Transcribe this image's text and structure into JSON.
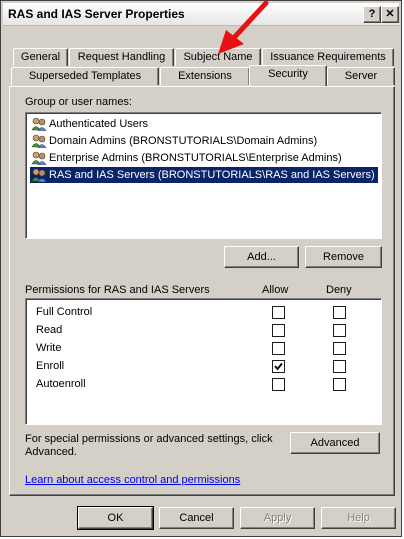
{
  "window": {
    "title": "RAS and IAS Server Properties",
    "help_glyph": "?",
    "close_glyph": "✕"
  },
  "tabs_row1": [
    "General",
    "Request Handling",
    "Subject Name",
    "Issuance Requirements"
  ],
  "tabs_row2": [
    "Superseded Templates",
    "Extensions",
    "Security",
    "Server"
  ],
  "active_tab": "Security",
  "group_label": "Group or user names:",
  "users": [
    {
      "name": "Authenticated Users",
      "selected": false
    },
    {
      "name": "Domain Admins (BRONSTUTORIALS\\Domain Admins)",
      "selected": false
    },
    {
      "name": "Enterprise Admins (BRONSTUTORIALS\\Enterprise Admins)",
      "selected": false
    },
    {
      "name": "RAS and IAS Servers (BRONSTUTORIALS\\RAS and IAS Servers)",
      "selected": true
    }
  ],
  "buttons": {
    "add": "Add...",
    "remove": "Remove",
    "advanced": "Advanced",
    "ok": "OK",
    "cancel": "Cancel",
    "apply": "Apply",
    "help": "Help"
  },
  "permissions": {
    "header": "Permissions for RAS and IAS Servers",
    "allow_label": "Allow",
    "deny_label": "Deny",
    "rows": [
      {
        "name": "Full Control",
        "allow": false,
        "deny": false
      },
      {
        "name": "Read",
        "allow": false,
        "deny": false
      },
      {
        "name": "Write",
        "allow": false,
        "deny": false
      },
      {
        "name": "Enroll",
        "allow": true,
        "deny": false
      },
      {
        "name": "Autoenroll",
        "allow": false,
        "deny": false
      }
    ]
  },
  "special_text_line1": "For special permissions or advanced settings, click",
  "special_text_line2": "Advanced.",
  "learn_link": "Learn about access control and permissions",
  "colors": {
    "selection": "#0a246a",
    "arrow": "#e81010",
    "face": "#d4d0c8"
  }
}
